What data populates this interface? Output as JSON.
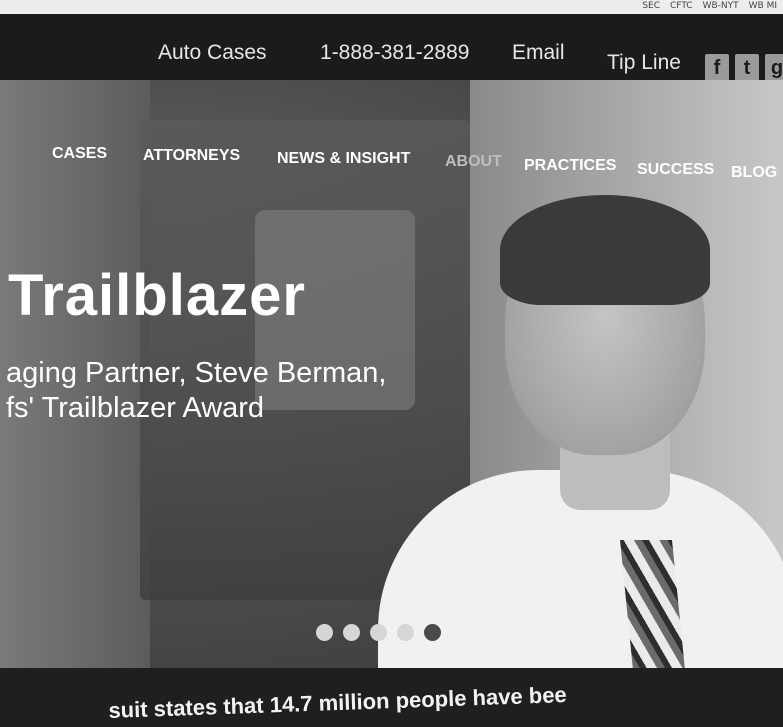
{
  "browser": {
    "bookmarks": [
      "SEC",
      "CFTC",
      "WB-NYT",
      "WB MI"
    ]
  },
  "topbar": {
    "auto_cases": "Auto Cases",
    "phone": "1-888-381-2889",
    "email": "Email",
    "tip_line": "Tip Line",
    "social": [
      {
        "icon": "facebook-icon",
        "glyph": "f"
      },
      {
        "icon": "twitter-icon",
        "glyph": "t"
      },
      {
        "icon": "social-icon",
        "glyph": "g"
      }
    ]
  },
  "nav": {
    "items": [
      "CASES",
      "ATTORNEYS",
      "NEWS & INSIGHT",
      "ABOUT",
      "PRACTICES",
      "SUCCESS",
      "BLOG"
    ]
  },
  "hero": {
    "headline": "Trailblazer",
    "sub_line_1": "aging Partner, Steve Berman,",
    "sub_line_2": "fs' Trailblazer Award",
    "slides": 5,
    "active_slide": 5
  },
  "ticker": {
    "text": "suit states that 14.7 million people have bee"
  },
  "colors": {
    "topbar_bg": "#1b1b1b",
    "nav_text": "#ffffff",
    "dot_active": "#4a4a4a",
    "dot_inactive": "#d6d6d6"
  }
}
